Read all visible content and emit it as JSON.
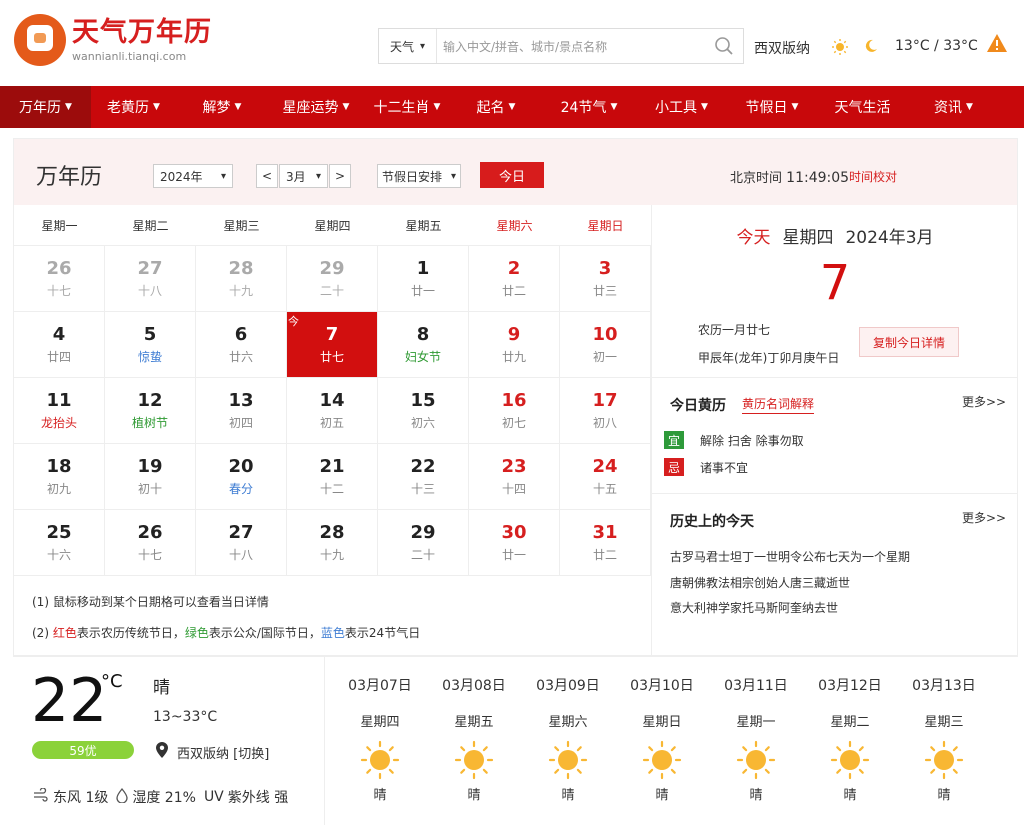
{
  "header": {
    "logo_title": "天气万年历",
    "logo_sub": "wannianli.tianqi.com",
    "search_type": "天气",
    "search_placeholder": "输入中文/拼音、城市/景点名称",
    "city": "西双版纳",
    "temp_range": "13°C / 33°C"
  },
  "nav": [
    "万年历",
    "老黄历",
    "解梦",
    "星座运势",
    "十二生肖",
    "起名",
    "24节气",
    "小工具",
    "节假日",
    "天气生活",
    "资讯"
  ],
  "calendar": {
    "title": "万年历",
    "year_select": "2024年",
    "prev": "<",
    "month_select": "3月",
    "next": ">",
    "holiday_select": "节假日安排",
    "today_button": "今日",
    "beijing_label": "北京时间",
    "beijing_time": "11:49:05",
    "time_fix": "时间校对",
    "weekdays": [
      "星期一",
      "星期二",
      "星期三",
      "星期四",
      "星期五",
      "星期六",
      "星期日"
    ],
    "today_tag": "今",
    "cells": [
      {
        "d": "26",
        "s": "十七"
      },
      {
        "d": "27",
        "s": "十八"
      },
      {
        "d": "28",
        "s": "十九"
      },
      {
        "d": "29",
        "s": "二十"
      },
      {
        "d": "1",
        "s": "廿一"
      },
      {
        "d": "2",
        "s": "廿二"
      },
      {
        "d": "3",
        "s": "廿三"
      },
      {
        "d": "4",
        "s": "廿四"
      },
      {
        "d": "5",
        "s": "惊蛰"
      },
      {
        "d": "6",
        "s": "廿六"
      },
      {
        "d": "7",
        "s": "廿七"
      },
      {
        "d": "8",
        "s": "妇女节"
      },
      {
        "d": "9",
        "s": "廿九"
      },
      {
        "d": "10",
        "s": "初一"
      },
      {
        "d": "11",
        "s": "龙抬头"
      },
      {
        "d": "12",
        "s": "植树节"
      },
      {
        "d": "13",
        "s": "初四"
      },
      {
        "d": "14",
        "s": "初五"
      },
      {
        "d": "15",
        "s": "初六"
      },
      {
        "d": "16",
        "s": "初七"
      },
      {
        "d": "17",
        "s": "初八"
      },
      {
        "d": "18",
        "s": "初九"
      },
      {
        "d": "19",
        "s": "初十"
      },
      {
        "d": "20",
        "s": "春分"
      },
      {
        "d": "21",
        "s": "十二"
      },
      {
        "d": "22",
        "s": "十三"
      },
      {
        "d": "23",
        "s": "十四"
      },
      {
        "d": "24",
        "s": "十五"
      },
      {
        "d": "25",
        "s": "十六"
      },
      {
        "d": "26",
        "s": "十七"
      },
      {
        "d": "27",
        "s": "十八"
      },
      {
        "d": "28",
        "s": "十九"
      },
      {
        "d": "29",
        "s": "二十"
      },
      {
        "d": "30",
        "s": "廿一"
      },
      {
        "d": "31",
        "s": "廿二"
      }
    ],
    "notes": {
      "n1": "(1) 鼠标移动到某个日期格可以查看当日详情",
      "n2_pre": "(2) ",
      "red": "红色",
      "red_desc": "表示农历传统节日，",
      "green": "绿色",
      "green_desc": "表示公众/国际节日，",
      "blue": "蓝色",
      "blue_desc": "表示24节气日"
    }
  },
  "today": {
    "label": "今天",
    "weekday": "星期四",
    "ym": "2024年3月",
    "day": "7",
    "lunar": "农历一月廿七",
    "ganzhi": "甲辰年(龙年)丁卯月庚午日",
    "copy_button": "复制今日详情"
  },
  "almanac": {
    "title": "今日黄历",
    "link": "黄历名词解释",
    "more": "更多>>",
    "yi_label": "宜",
    "yi": "解除 扫舍 除事勿取",
    "ji_label": "忌",
    "ji": "诸事不宜"
  },
  "history": {
    "title": "历史上的今天",
    "more": "更多>>",
    "items": [
      "古罗马君士坦丁一世明令公布七天为一个星期",
      "唐朝佛教法相宗创始人唐三藏逝世",
      "意大利神学家托马斯阿奎纳去世"
    ]
  },
  "weather": {
    "temp": "22",
    "unit": "°C",
    "condition": "晴",
    "range": "13~33°C",
    "aqi": "59优",
    "location": "西双版纳 [切换]",
    "wind": "东风 1级",
    "humidity": "湿度 21%",
    "uv_label": "UV",
    "uv": "紫外线 强",
    "forecast": [
      {
        "date": "03月07日",
        "weekday": "星期四",
        "cond": "晴"
      },
      {
        "date": "03月08日",
        "weekday": "星期五",
        "cond": "晴"
      },
      {
        "date": "03月09日",
        "weekday": "星期六",
        "cond": "晴"
      },
      {
        "date": "03月10日",
        "weekday": "星期日",
        "cond": "晴"
      },
      {
        "date": "03月11日",
        "weekday": "星期一",
        "cond": "晴"
      },
      {
        "date": "03月12日",
        "weekday": "星期二",
        "cond": "晴"
      },
      {
        "date": "03月13日",
        "weekday": "星期三",
        "cond": "晴"
      }
    ]
  },
  "colors": {
    "brand_red": "#c8080b",
    "today_red": "#d20f0f",
    "green": "#2e9a3a",
    "blue": "#3f7dd3",
    "aqi": "#8bd23a"
  }
}
